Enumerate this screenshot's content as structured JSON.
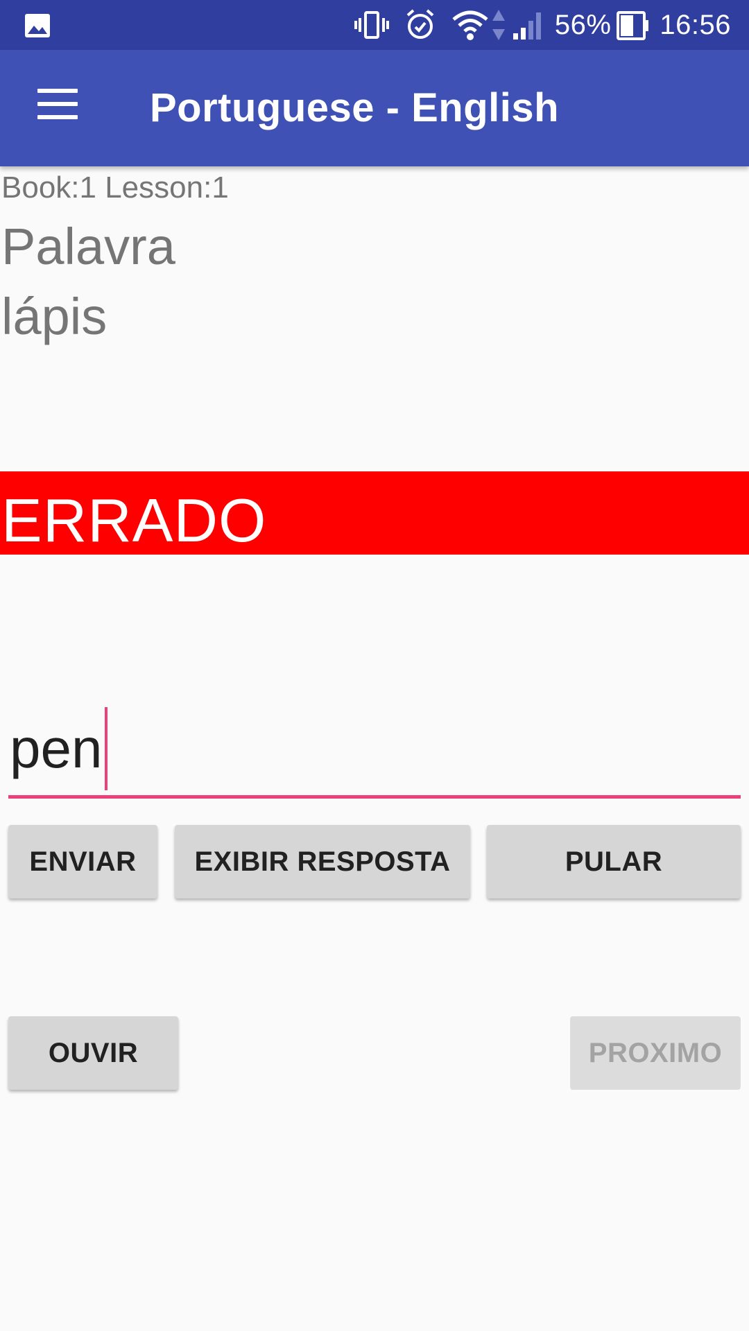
{
  "status_bar": {
    "left_icon": "gallery-icon",
    "icons": [
      "vibrate-icon",
      "alarm-icon",
      "wifi-icon",
      "data-arrows-icon",
      "signal-icon"
    ],
    "battery_percent": "56%",
    "battery_icon": "battery-icon",
    "time": "16:56"
  },
  "app_bar": {
    "menu_icon": "hamburger-menu-icon",
    "title": "Portuguese - English"
  },
  "lesson": {
    "info": "Book:1 Lesson:1",
    "label": "Palavra",
    "word": "lápis"
  },
  "result": {
    "text": "ERRADO",
    "color": "#ff0000"
  },
  "answer": {
    "value": "pen",
    "accent": "#ec407a"
  },
  "buttons": {
    "send": "ENVIAR",
    "show_answer": "EXIBIR RESPOSTA",
    "skip": "PULAR",
    "listen": "OUVIR",
    "next": "PROXIMO"
  },
  "colors": {
    "status_bar": "#303f9f",
    "app_bar": "#3f51b5",
    "background": "#fafafa",
    "button": "#d6d6d6"
  }
}
